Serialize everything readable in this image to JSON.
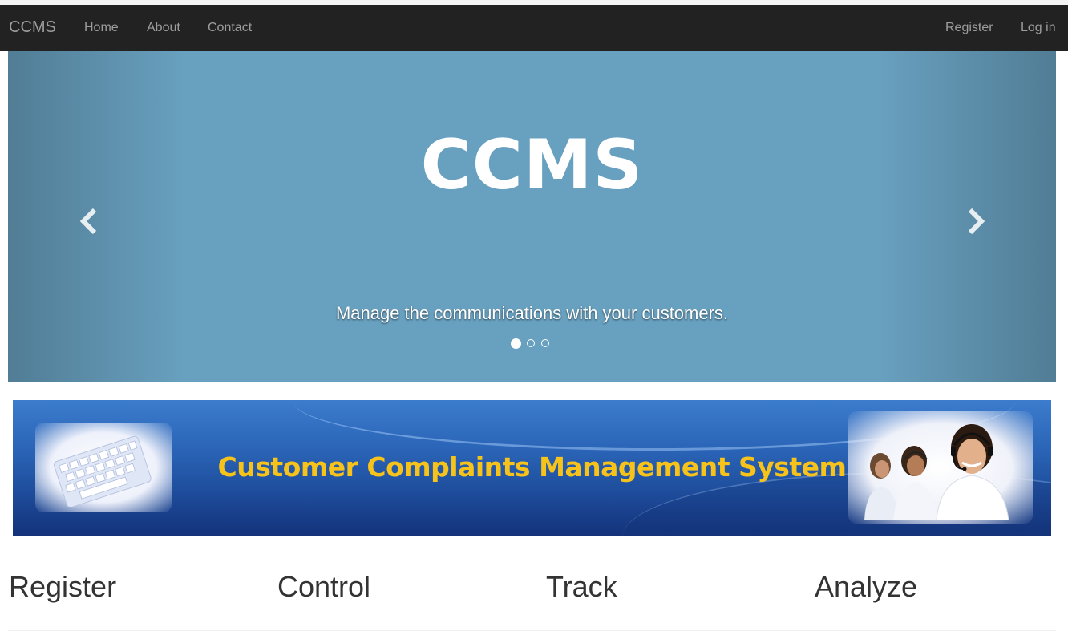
{
  "navbar": {
    "brand": "CCMS",
    "links": [
      "Home",
      "About",
      "Contact"
    ],
    "right_links": [
      "Register",
      "Log in"
    ]
  },
  "carousel": {
    "title": "CCMS",
    "caption": "Manage the communications with your customers.",
    "indicator_count": 3,
    "active_index": 0,
    "prev_icon": "chevron-left-icon",
    "next_icon": "chevron-right-icon"
  },
  "banner": {
    "text": "Customer Complaints Management System",
    "left_image": "keyboard-image",
    "right_image": "call-center-agents-image"
  },
  "features": [
    "Register",
    "Control",
    "Track",
    "Analyze"
  ],
  "colors": {
    "navbar_bg": "#222222",
    "nav_text": "#9d9d9d",
    "carousel_bg": "#68a0bf",
    "banner_text": "#f7c21a",
    "heading_text": "#333333"
  }
}
